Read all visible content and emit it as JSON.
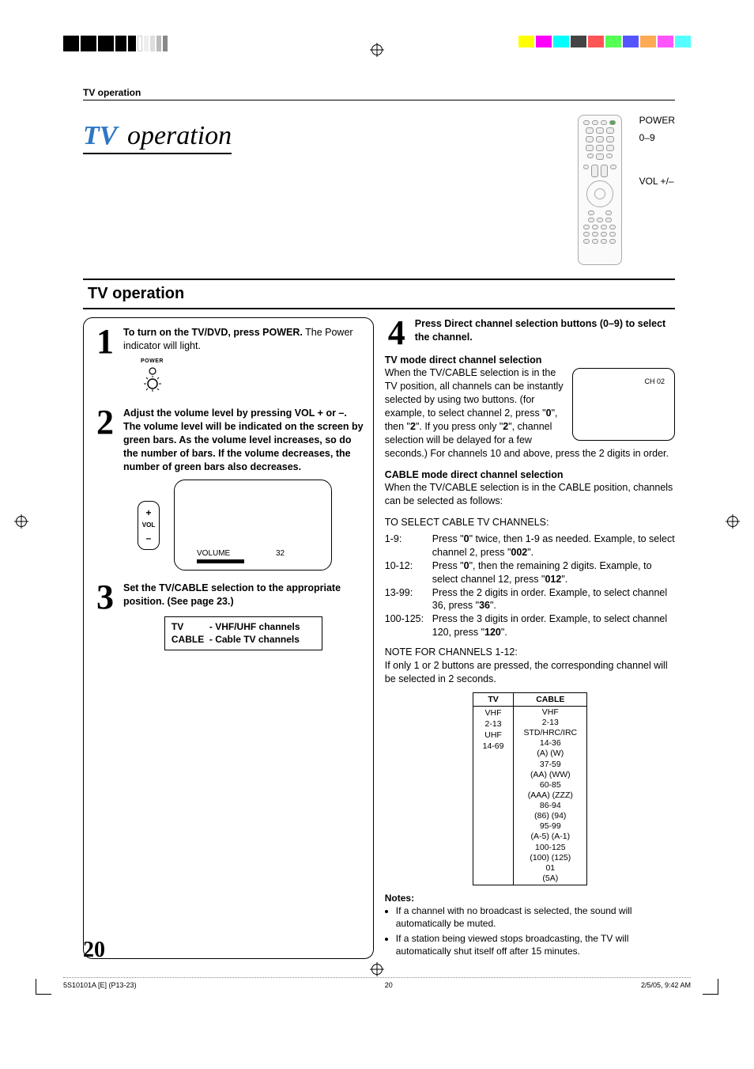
{
  "running_head": "TV operation",
  "title_tv": "TV",
  "title_rest": " operation",
  "remote_labels": {
    "power": "POWER",
    "num": "0–9",
    "vol": "VOL +/–"
  },
  "section_heading": "TV operation",
  "step1": {
    "num": "1",
    "bold": "To turn on the TV/DVD, press POWER.",
    "text": "The Power indicator will light.",
    "power_label": "POWER"
  },
  "step2": {
    "num": "2",
    "bold": "Adjust the volume level by pressing VOL + or –. The volume level will be indicated on the screen by green bars. As the volume level increases, so do the number of bars. If the volume decreases, the number of green bars also decreases.",
    "vol_btn_top": "+",
    "vol_btn_mid": "VOL",
    "vol_btn_bot": "–",
    "screen_label": "VOLUME",
    "screen_value": "32"
  },
  "step3": {
    "num": "3",
    "bold": "Set the TV/CABLE selection to the appropriate position. (See page 23.)",
    "box_tv": "TV",
    "box_tv_desc": "- VHF/UHF channels",
    "box_cable": "CABLE",
    "box_cable_desc": "- Cable TV channels"
  },
  "step4": {
    "num": "4",
    "bold": "Press Direct channel selection buttons (0–9) to select the channel.",
    "tv_head": "TV mode direct channel selection",
    "tv_para1": "When the TV/CABLE selection is in the TV position, all channels can be instantly selected by using two buttons. (for example, to select channel 2, press \"",
    "tv_b1": "0",
    "tv_para1b": "\", then \"",
    "tv_b2": "2",
    "tv_para1c": "\". If you press only \"",
    "tv_b3": "2",
    "tv_para1d": "\", channel selection will be delayed for a few seconds.) For channels 10 and above, press the 2 digits in order.",
    "screen_ch": "CH 02",
    "cable_head": "CABLE mode direct channel selection",
    "cable_para": "When the TV/CABLE selection is in the CABLE position, channels can be selected as follows:",
    "cable_select_head": "TO SELECT CABLE TV CHANNELS:",
    "rows": [
      {
        "k": "1-9:",
        "v_a": "Press \"",
        "b": "0",
        "v_b": "\" twice, then 1-9 as needed. Example, to select channel 2, press \"",
        "b2": "002",
        "v_c": "\"."
      },
      {
        "k": "10-12:",
        "v_a": "Press \"",
        "b": "0",
        "v_b": "\", then the remaining 2 digits. Example, to select channel 12, press \"",
        "b2": "012",
        "v_c": "\"."
      },
      {
        "k": "13-99:",
        "v_a": "Press the 2 digits in order. Example, to select channel 36, press \"",
        "b": "",
        "v_b": "",
        "b2": "36",
        "v_c": "\"."
      },
      {
        "k": "100-125:",
        "v_a": "Press the 3 digits in order. Example, to select channel 120, press \"",
        "b": "",
        "v_b": "",
        "b2": "120",
        "v_c": "\"."
      }
    ],
    "note_head": "NOTE FOR CHANNELS 1-12:",
    "note_body": "If only 1 or 2 buttons are pressed, the corresponding channel will be selected in 2 seconds."
  },
  "freq_table": {
    "headers": [
      "TV",
      "CABLE"
    ],
    "tv_lines": [
      "VHF",
      "2-13",
      "UHF",
      "14-69"
    ],
    "cable_lines": [
      "VHF",
      "2-13",
      "STD/HRC/IRC",
      "14-36",
      "(A) (W)",
      "37-59",
      "(AA) (WW)",
      "60-85",
      "(AAA) (ZZZ)",
      "86-94",
      "(86) (94)",
      "95-99",
      "(A-5) (A-1)",
      "100-125",
      "(100) (125)",
      "01",
      "(5A)"
    ]
  },
  "notes": {
    "head": "Notes:",
    "items": [
      "If a channel with no broadcast is selected, the sound will automatically be muted.",
      "If a station being viewed stops broadcasting, the TV will automatically shut itself off after 15 minutes."
    ]
  },
  "page_number": "20",
  "footer": {
    "left": "5S10101A [E] (P13-23)",
    "center": "20",
    "right": "2/5/05, 9:42 AM"
  }
}
